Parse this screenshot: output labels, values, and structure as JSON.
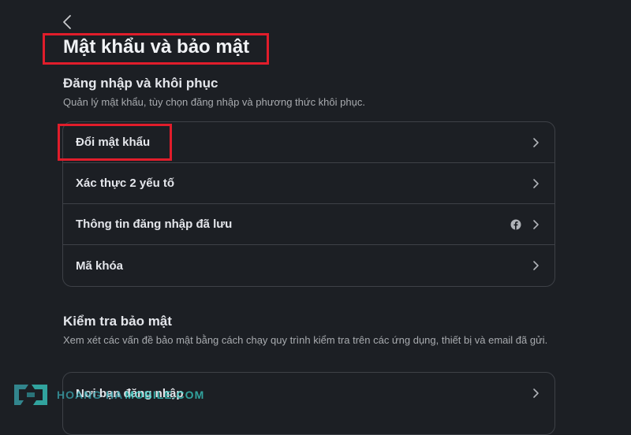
{
  "page": {
    "title": "Mật khẩu và bảo mật"
  },
  "login_section": {
    "title": "Đăng nhập và khôi phục",
    "description": "Quản lý mật khẩu, tùy chọn đăng nhập và phương thức khôi phục.",
    "items": [
      {
        "label": "Đổi mật khẩu"
      },
      {
        "label": "Xác thực 2 yếu tố"
      },
      {
        "label": "Thông tin đăng nhập đã lưu",
        "icon": "facebook-icon"
      },
      {
        "label": "Mã khóa"
      }
    ]
  },
  "security_check_section": {
    "title": "Kiểm tra bảo mật",
    "description": "Xem xét các vấn đề bảo mật bằng cách chạy quy trình kiểm tra trên các ứng dụng, thiết bị và email đã gửi.",
    "items": [
      {
        "label": "Nơi bạn đăng nhập"
      }
    ]
  },
  "watermark": {
    "part1": "HOANG HA",
    "part2": "MOBILE.COM"
  },
  "colors": {
    "background": "#1c1f24",
    "highlight": "#e11d2b",
    "border": "#3e4147"
  }
}
